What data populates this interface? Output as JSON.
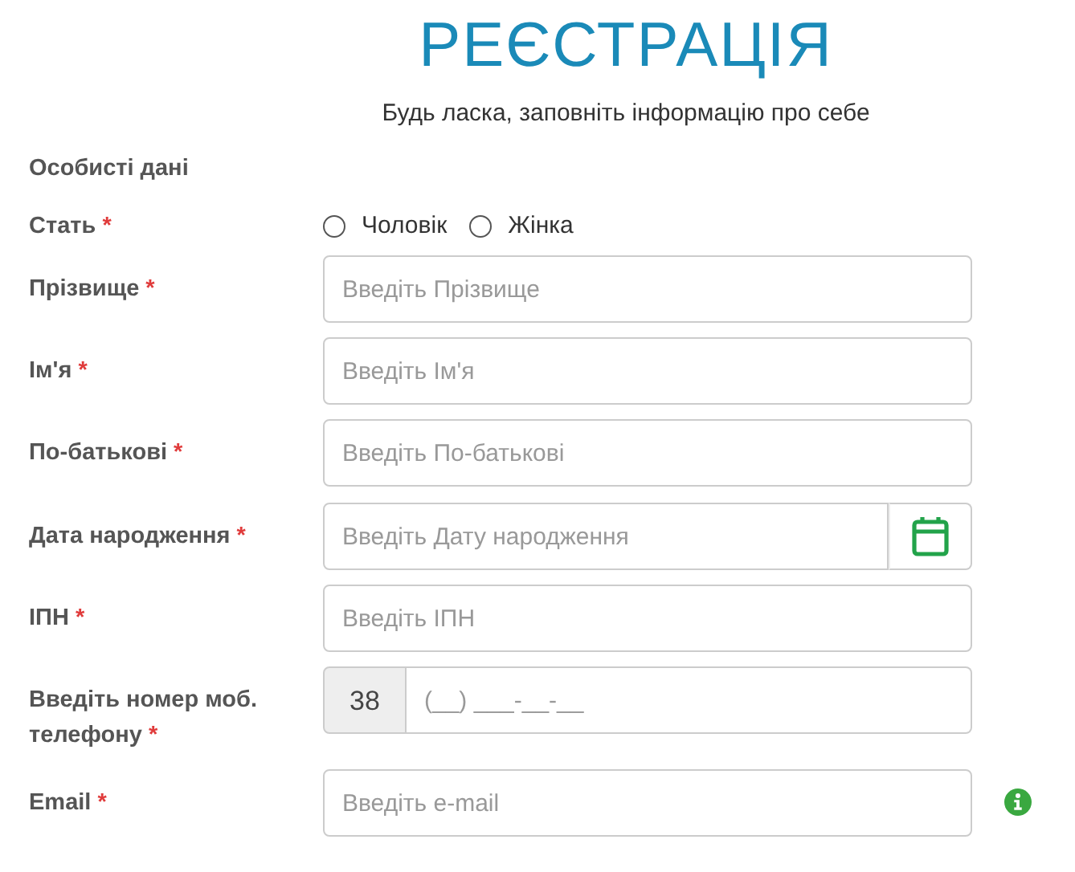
{
  "title": "РЕЄСТРАЦІЯ",
  "subtitle": "Будь ласка, заповніть інформацію про себе",
  "section": "Особисті дані",
  "gender": {
    "label": "Стать",
    "required_mark": "*",
    "options": [
      {
        "label": "Чоловік",
        "selected": false
      },
      {
        "label": "Жінка",
        "selected": false
      }
    ]
  },
  "fields": [
    {
      "kind": "text",
      "label": "Прізвище",
      "required_mark": "*",
      "placeholder": "Введіть Прізвище"
    },
    {
      "kind": "text",
      "label": "Ім'я",
      "required_mark": "*",
      "placeholder": "Введіть Ім'я"
    },
    {
      "kind": "text",
      "label": "По-батькові",
      "required_mark": "*",
      "placeholder": "Введіть По-батькові"
    },
    {
      "kind": "date",
      "label": "Дата народження",
      "required_mark": "*",
      "placeholder": "Введіть Дату народження"
    },
    {
      "kind": "text",
      "label": "ІПН",
      "required_mark": "*",
      "placeholder": "Введіть ІПН"
    },
    {
      "kind": "phone",
      "label": "Введіть номер моб. телефону",
      "required_mark": "*",
      "prefix": "38",
      "placeholder": "(__) ___-__-__"
    },
    {
      "kind": "email",
      "label": "Email",
      "required_mark": "*",
      "placeholder": "Введіть e-mail"
    }
  ]
}
